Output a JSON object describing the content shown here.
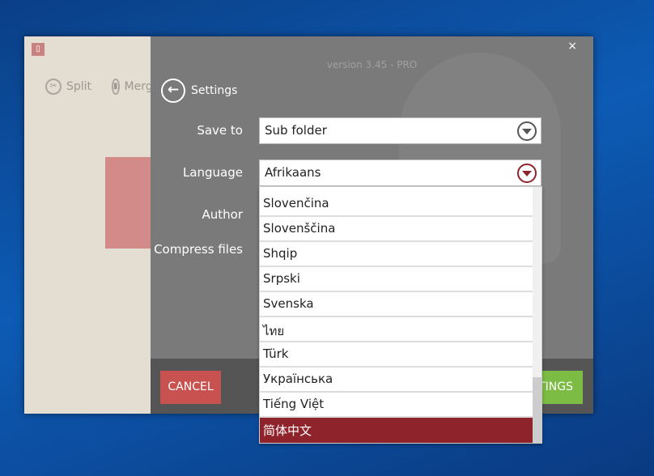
{
  "app": {
    "version": "version 3.45 - PRO",
    "close": "×",
    "logo": "logo"
  },
  "toolbar": [
    {
      "label": "Split",
      "icon": "scissors-icon"
    },
    {
      "label": "Merge",
      "icon": "document-icon"
    }
  ],
  "settings": {
    "title": "Settings",
    "save_to_label": "Save to",
    "save_to_value": "Sub folder",
    "language_label": "Language",
    "language_value": "Afrikaans",
    "author_label": "Author",
    "compress_label": "Compress files"
  },
  "buttons": {
    "cancel": "CANCEL",
    "save": "TINGS"
  },
  "languages": [
    "Slovenčina",
    "Slovenščina",
    "Shqip",
    "Srpski",
    "Svenska",
    "ไทย",
    "Türk",
    "Українська",
    "Tiếng Việt",
    "简体中文"
  ],
  "selected_language": "简体中文",
  "colors": {
    "accent": "#8f232b",
    "cancel": "#c85250",
    "save": "#7cbc45",
    "panel": "#7a7a7a"
  }
}
